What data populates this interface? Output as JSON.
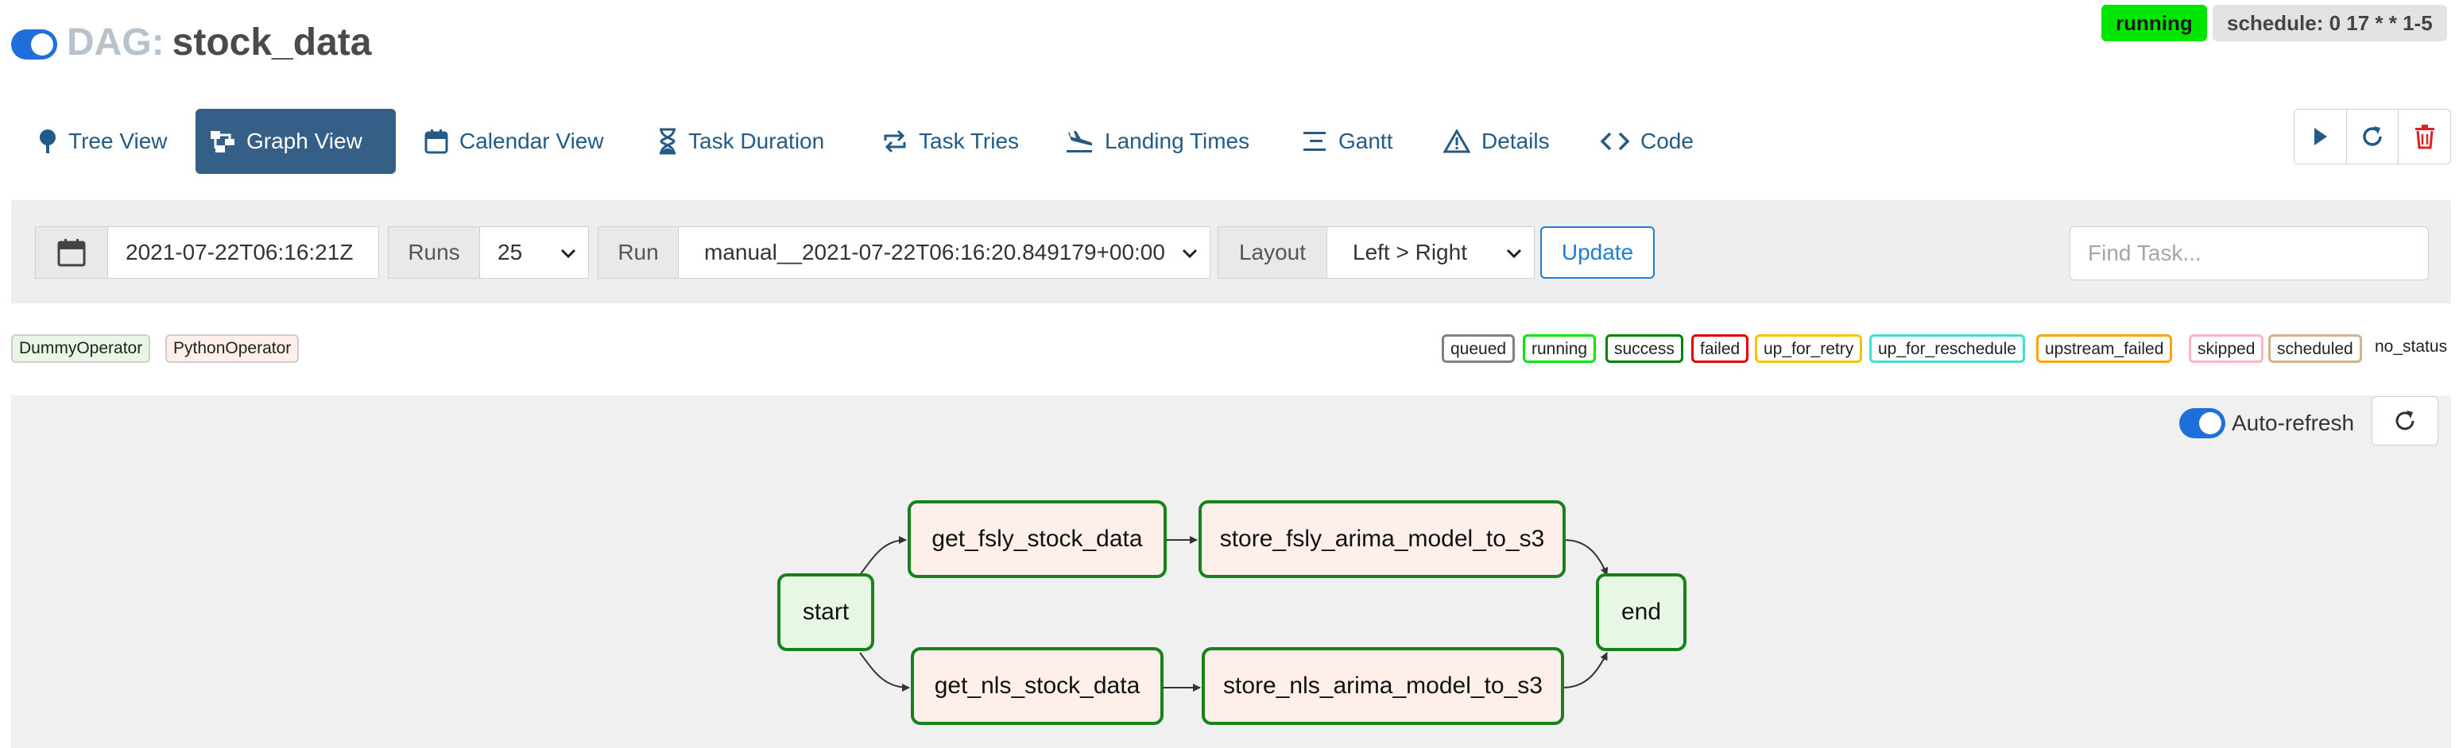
{
  "header": {
    "dag_prefix": "DAG:",
    "dag_id": "stock_data",
    "state_badge": "running",
    "schedule_badge": "schedule: 0 17 * * 1-5"
  },
  "tabs": [
    {
      "label": "Tree View",
      "icon": "tree-icon"
    },
    {
      "label": "Graph View",
      "icon": "graph-icon",
      "active": true
    },
    {
      "label": "Calendar View",
      "icon": "calendar-icon"
    },
    {
      "label": "Task Duration",
      "icon": "hourglass-icon"
    },
    {
      "label": "Task Tries",
      "icon": "retry-icon"
    },
    {
      "label": "Landing Times",
      "icon": "landing-icon"
    },
    {
      "label": "Gantt",
      "icon": "gantt-icon"
    },
    {
      "label": "Details",
      "icon": "warning-triangle-icon"
    },
    {
      "label": "Code",
      "icon": "code-icon"
    }
  ],
  "actions": [
    "trigger-dag-button",
    "refresh-dag-button",
    "delete-dag-button"
  ],
  "controls": {
    "base_date": "2021-07-22T06:16:21Z",
    "runs_label": "Runs",
    "runs_value": "25",
    "run_label": "Run",
    "run_value": "manual__2021-07-22T06:16:20.849179+00:00",
    "layout_label": "Layout",
    "layout_value": "Left > Right",
    "update_label": "Update",
    "find_task_placeholder": "Find Task..."
  },
  "operators": [
    "DummyOperator",
    "PythonOperator"
  ],
  "states": [
    {
      "label": "queued",
      "color": "#808080"
    },
    {
      "label": "running",
      "color": "#00e600"
    },
    {
      "label": "success",
      "color": "#008000"
    },
    {
      "label": "failed",
      "color": "#e00000"
    },
    {
      "label": "up_for_retry",
      "color": "#f5c400"
    },
    {
      "label": "up_for_reschedule",
      "color": "#40e0d0"
    },
    {
      "label": "upstream_failed",
      "color": "#ffa500"
    },
    {
      "label": "skipped",
      "color": "#ffb6c1"
    },
    {
      "label": "scheduled",
      "color": "#d2b48c"
    },
    {
      "label": "no_status",
      "color": ""
    }
  ],
  "graph": {
    "auto_refresh_label": "Auto-refresh",
    "nodes": {
      "start": "start",
      "get_fsly": "get_fsly_stock_data",
      "get_nls": "get_nls_stock_data",
      "store_fsly": "store_fsly_arima_model_to_s3",
      "store_nls": "store_nls_arima_model_to_s3",
      "end": "end"
    }
  },
  "colors": {
    "accent": "#1e6fd9",
    "active_tab": "#365f87",
    "success_border": "#17821a",
    "dummy_fill": "#e8f7e4",
    "python_fill": "#ffefeb"
  }
}
